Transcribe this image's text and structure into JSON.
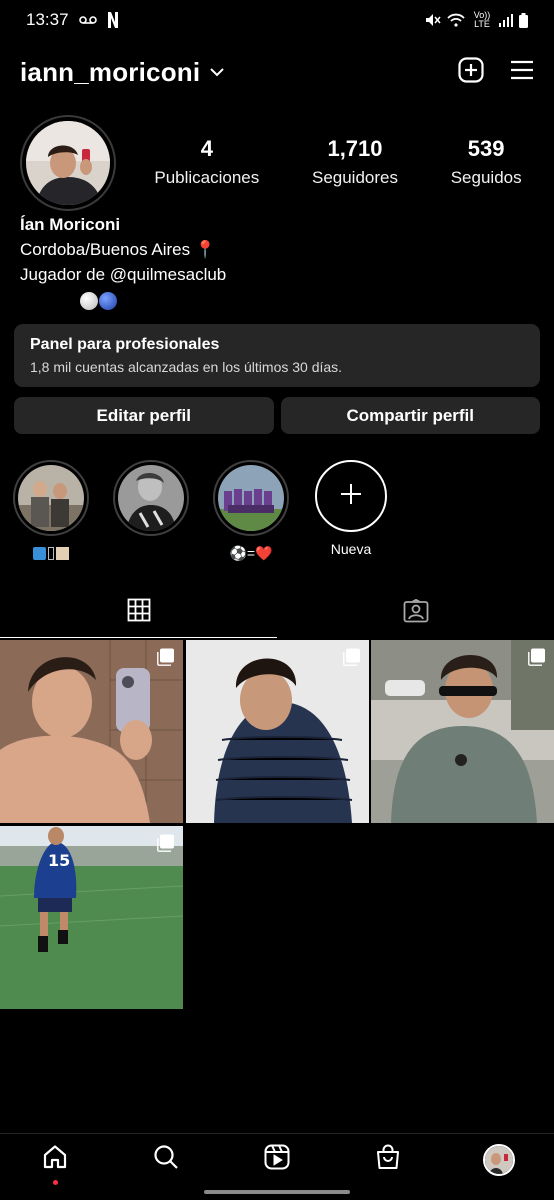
{
  "status_bar": {
    "time": "13:37",
    "network": "Vo)) LTE"
  },
  "header": {
    "username": "iann_moriconi"
  },
  "profile": {
    "stats": [
      {
        "value": "4",
        "label": "Publicaciones"
      },
      {
        "value": "1,710",
        "label": "Seguidores"
      },
      {
        "value": "539",
        "label": "Seguidos"
      }
    ],
    "name": "Ían Moriconi",
    "bio_line1": "Cordoba/Buenos Aires 📍",
    "bio_line2": "Jugador de @quilmesaclub"
  },
  "pro_panel": {
    "title": "Panel para profesionales",
    "subtitle": "1,8 mil cuentas alcanzadas en los últimos 30 días."
  },
  "buttons": {
    "edit": "Editar perfil",
    "share": "Compartir perfil"
  },
  "highlights": [
    {
      "label": ""
    },
    {
      "label": ""
    },
    {
      "label": "⚽=❤️"
    },
    {
      "label": "Nueva"
    }
  ],
  "tabs": [
    "grid-icon",
    "tagged-icon"
  ],
  "posts": [
    {
      "id": "post-1",
      "multi": true
    },
    {
      "id": "post-2",
      "multi": true
    },
    {
      "id": "post-3",
      "multi": true
    },
    {
      "id": "post-4",
      "multi": true
    }
  ],
  "colors": {
    "accent": "#ff3040",
    "panel": "#262626",
    "ball_blue": "#2456c9"
  }
}
